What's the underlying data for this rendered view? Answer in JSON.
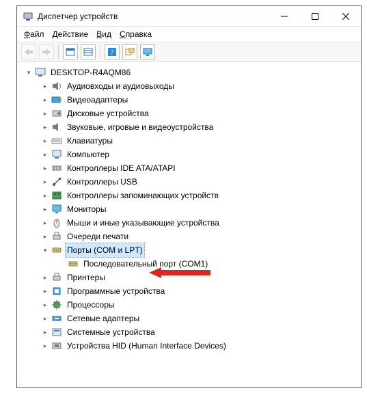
{
  "window": {
    "title": "Диспетчер устройств"
  },
  "menu": {
    "file": "Файл",
    "action": "Действие",
    "view": "Вид",
    "help": "Справка"
  },
  "tree": {
    "root": "DESKTOP-R4AQM86",
    "items": [
      {
        "label": "Аудиовходы и аудиовыходы"
      },
      {
        "label": "Видеоадаптеры"
      },
      {
        "label": "Дисковые устройства"
      },
      {
        "label": "Звуковые, игровые и видеоустройства"
      },
      {
        "label": "Клавиатуры"
      },
      {
        "label": "Компьютер"
      },
      {
        "label": "Контроллеры IDE ATA/ATAPI"
      },
      {
        "label": "Контроллеры USB"
      },
      {
        "label": "Контроллеры запоминающих устройств"
      },
      {
        "label": "Мониторы"
      },
      {
        "label": "Мыши и иные указывающие устройства"
      },
      {
        "label": "Очереди печати"
      },
      {
        "label": "Порты (COM и LPT)"
      },
      {
        "label": "Последовательный порт (COM1)"
      },
      {
        "label": "Принтеры"
      },
      {
        "label": "Программные устройства"
      },
      {
        "label": "Процессоры"
      },
      {
        "label": "Сетевые адаптеры"
      },
      {
        "label": "Системные устройства"
      },
      {
        "label": "Устройства HID (Human Interface Devices)"
      }
    ]
  }
}
